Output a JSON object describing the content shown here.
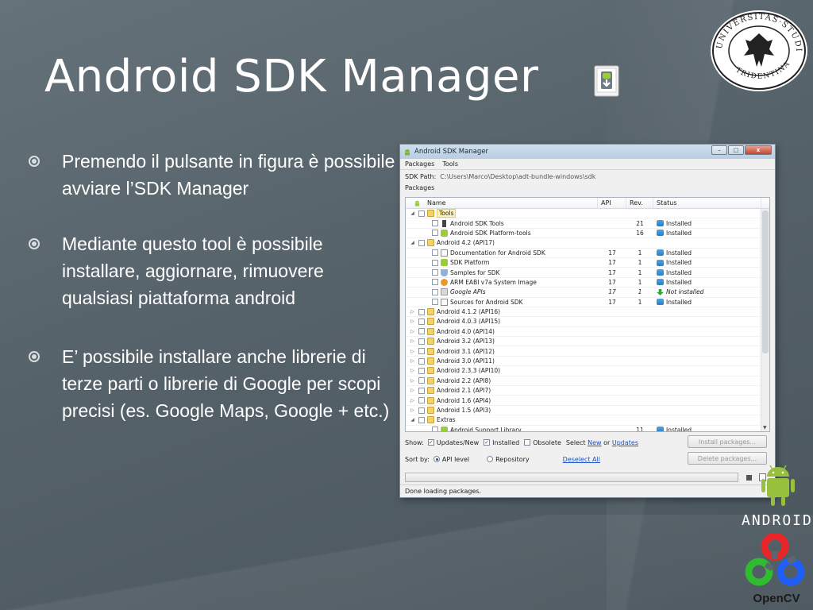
{
  "slide": {
    "title": "Android SDK Manager",
    "bullets": [
      "Premendo il pulsante in figura è possibile avviare l’SDK Manager",
      "Mediante questo tool è possibile installare, aggiornare, rimuovere qualsiasi piattaforma android",
      "E’ possibile installare anche librerie di terze parti o librerie di Google per scopi precisi (es. Google Maps, Google + etc.)"
    ],
    "logos": {
      "android_word": "ANDROID",
      "opencv_word": "OpenCV"
    },
    "colors": {
      "title": "#ffffff",
      "background": "#5b676f"
    }
  },
  "sdk_window": {
    "title": "Android SDK Manager",
    "window_buttons": {
      "minimize": "–",
      "maximize": "□",
      "close": "x"
    },
    "menu": [
      "Packages",
      "Tools"
    ],
    "sdk_path_label": "SDK Path:",
    "sdk_path_value": "C:\\Users\\Marco\\Desktop\\adt-bundle-windows\\sdk",
    "packages_label": "Packages",
    "columns": [
      "Name",
      "API",
      "Rev.",
      "Status"
    ],
    "rows": [
      {
        "name": "Tools",
        "api": "",
        "rev": "",
        "status": "",
        "level": 0,
        "expanded": true,
        "icon": "folder-icon",
        "highlight": true
      },
      {
        "name": "Android SDK Tools",
        "api": "",
        "rev": "21",
        "status": "Installed",
        "level": 1,
        "icon": "tools-icon"
      },
      {
        "name": "Android SDK Platform-tools",
        "api": "",
        "rev": "16",
        "status": "Installed",
        "level": 1,
        "icon": "platform-tools-icon"
      },
      {
        "name": "Android 4.2 (API17)",
        "api": "",
        "rev": "",
        "status": "",
        "level": 0,
        "expanded": true,
        "icon": "folder-icon"
      },
      {
        "name": "Documentation for Android SDK",
        "api": "17",
        "rev": "1",
        "status": "Installed",
        "level": 1,
        "icon": "document-icon"
      },
      {
        "name": "SDK Platform",
        "api": "17",
        "rev": "1",
        "status": "Installed",
        "level": 1,
        "icon": "platform-icon"
      },
      {
        "name": "Samples for SDK",
        "api": "17",
        "rev": "1",
        "status": "Installed",
        "level": 1,
        "icon": "samples-icon"
      },
      {
        "name": "ARM EABI v7a System Image",
        "api": "17",
        "rev": "1",
        "status": "Installed",
        "level": 1,
        "icon": "system-image-icon"
      },
      {
        "name": "Google APIs",
        "api": "17",
        "rev": "1",
        "status": "Not installed",
        "level": 1,
        "icon": "google-apis-icon",
        "italic": true
      },
      {
        "name": "Sources for Android SDK",
        "api": "17",
        "rev": "1",
        "status": "Installed",
        "level": 1,
        "icon": "sources-icon"
      },
      {
        "name": "Android 4.1.2 (API16)",
        "api": "",
        "rev": "",
        "status": "",
        "level": 0,
        "expanded": false,
        "icon": "folder-icon"
      },
      {
        "name": "Android 4.0.3 (API15)",
        "api": "",
        "rev": "",
        "status": "",
        "level": 0,
        "expanded": false,
        "icon": "folder-icon"
      },
      {
        "name": "Android 4.0 (API14)",
        "api": "",
        "rev": "",
        "status": "",
        "level": 0,
        "expanded": false,
        "icon": "folder-icon"
      },
      {
        "name": "Android 3.2 (API13)",
        "api": "",
        "rev": "",
        "status": "",
        "level": 0,
        "expanded": false,
        "icon": "folder-icon"
      },
      {
        "name": "Android 3.1 (API12)",
        "api": "",
        "rev": "",
        "status": "",
        "level": 0,
        "expanded": false,
        "icon": "folder-icon"
      },
      {
        "name": "Android 3.0 (API11)",
        "api": "",
        "rev": "",
        "status": "",
        "level": 0,
        "expanded": false,
        "icon": "folder-icon"
      },
      {
        "name": "Android 2.3.3 (API10)",
        "api": "",
        "rev": "",
        "status": "",
        "level": 0,
        "expanded": false,
        "icon": "folder-icon"
      },
      {
        "name": "Android 2.2 (API8)",
        "api": "",
        "rev": "",
        "status": "",
        "level": 0,
        "expanded": false,
        "icon": "folder-icon"
      },
      {
        "name": "Android 2.1 (API7)",
        "api": "",
        "rev": "",
        "status": "",
        "level": 0,
        "expanded": false,
        "icon": "folder-icon"
      },
      {
        "name": "Android 1.6 (API4)",
        "api": "",
        "rev": "",
        "status": "",
        "level": 0,
        "expanded": false,
        "icon": "folder-icon"
      },
      {
        "name": "Android 1.5 (API3)",
        "api": "",
        "rev": "",
        "status": "",
        "level": 0,
        "expanded": false,
        "icon": "folder-icon"
      },
      {
        "name": "Extras",
        "api": "",
        "rev": "",
        "status": "",
        "level": 0,
        "expanded": true,
        "icon": "folder-icon"
      },
      {
        "name": "Android Support Library",
        "api": "",
        "rev": "11",
        "status": "Installed",
        "level": 1,
        "icon": "library-icon"
      }
    ],
    "show": {
      "label": "Show:",
      "updates_new": "Updates/New",
      "installed": "Installed",
      "obsolete": "Obsolete",
      "select_prefix": "Select",
      "new_link": "New",
      "or": "or",
      "updates_link": "Updates"
    },
    "sort": {
      "label": "Sort by:",
      "api_level": "API level",
      "repository": "Repository",
      "deselect_all": "Deselect All"
    },
    "buttons": {
      "install": "Install packages...",
      "delete": "Delete packages..."
    },
    "status_text": "Done loading packages."
  }
}
